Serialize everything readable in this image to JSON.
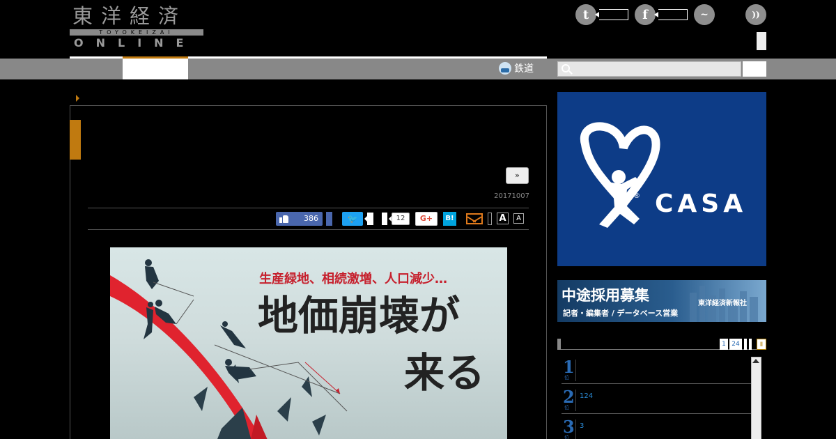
{
  "header": {
    "logo": {
      "kanji": "東洋経済",
      "sub": "TOYOKEIZAI",
      "online": "ONLINE"
    },
    "social": [
      {
        "name": "twitter-icon",
        "glyph": "t"
      },
      {
        "name": "facebook-icon",
        "glyph": "f"
      },
      {
        "name": "messenger-icon",
        "glyph": "~"
      },
      {
        "name": "rss-icon",
        "glyph": "))"
      }
    ]
  },
  "nav": {
    "rail_label": "鉄道",
    "search_placeholder": ""
  },
  "article": {
    "next_label": "»",
    "date": "20171007",
    "share": {
      "like_count": "386",
      "plusone_count": "12",
      "gplus_label": "G+",
      "hatebu_label": "B!",
      "font_large": "A",
      "font_small": "A"
    },
    "hero": {
      "subtitle": "生産緑地、相続激増、人口減少…",
      "title_line1": "地価崩壊が",
      "title_line2": "来る"
    }
  },
  "sidebar": {
    "ad_casa": {
      "text": "CASA",
      "mark": "®"
    },
    "recruit": {
      "title": "中途採用募集",
      "subtitle": "記者・編集者 / データベース営業",
      "company": "東洋経済新報社"
    },
    "ranking": {
      "tabs": [
        "1",
        "24",
        "",
        "",
        "Ⅱ"
      ],
      "items": [
        {
          "rank": "1",
          "suffix": "位",
          "text": ""
        },
        {
          "rank": "2",
          "suffix": "位",
          "text": "124"
        },
        {
          "rank": "3",
          "suffix": "位",
          "text": "3"
        }
      ]
    }
  },
  "colors": {
    "accent": "#c07a10",
    "nav_bg": "#888888",
    "casa_blue": "#0d3c87",
    "rank_blue": "#2a6bb5",
    "hero_red": "#c6202d"
  }
}
